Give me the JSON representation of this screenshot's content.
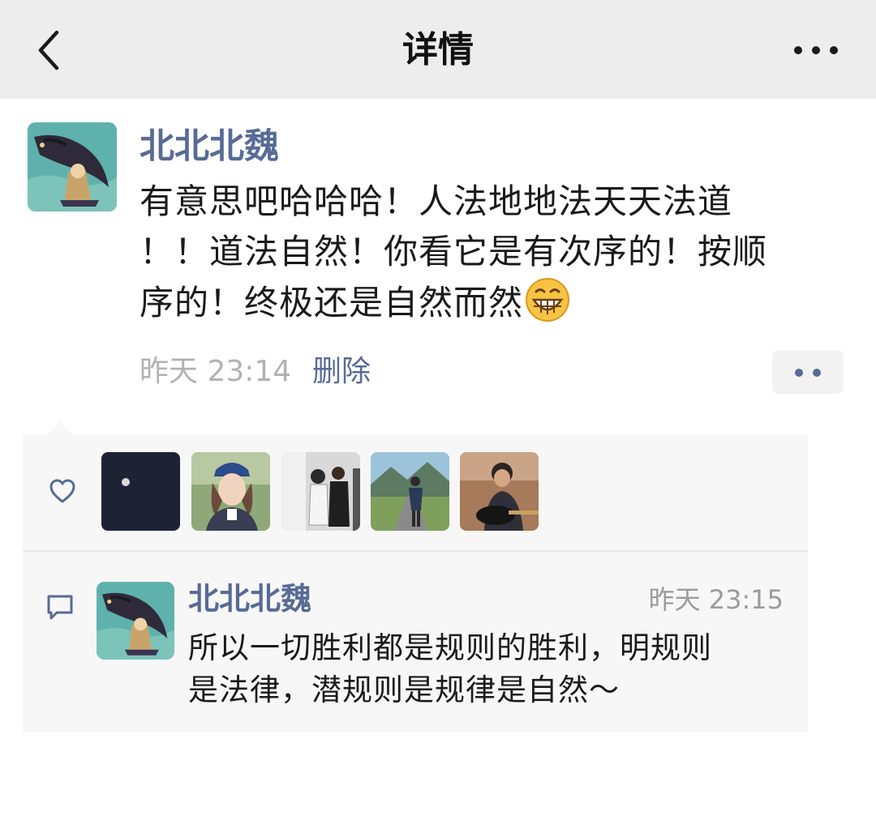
{
  "nav": {
    "title": "详情",
    "back_icon": "chevron-left-icon",
    "more_icon": "more-horizontal-icon"
  },
  "post": {
    "author": "北北北魏",
    "lines": [
      "有意思吧哈哈哈！人法地地法天天法道",
      "！！道法自然！你看它是有次序的！按顺",
      "序的！终极还是自然而然"
    ],
    "emoji": "grinning-face-emoji",
    "time": "昨天 23:14",
    "delete_label": "删除"
  },
  "likes": {
    "icon": "heart-icon",
    "avatars": [
      "liker-avatar-1",
      "liker-avatar-2",
      "liker-avatar-3",
      "liker-avatar-4",
      "liker-avatar-5"
    ]
  },
  "comment": {
    "icon": "comment-icon",
    "author": "北北北魏",
    "time": "昨天 23:15",
    "lines": [
      "所以一切胜利都是规则的胜利，明规则",
      "是法律，潜规则是规律是自然～"
    ]
  },
  "colors": {
    "link": "#576b95",
    "navbar_bg": "#ededed",
    "panel_bg": "#f7f7f7",
    "muted": "#b2b2b2"
  }
}
